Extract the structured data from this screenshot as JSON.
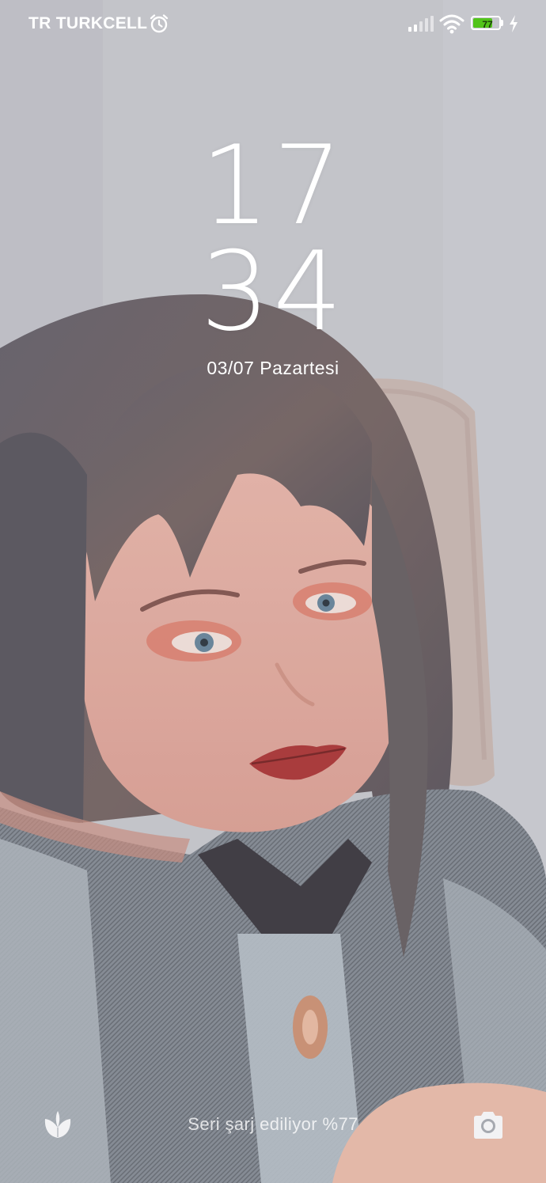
{
  "status_bar": {
    "carrier": "TR TURKCELL",
    "battery_level": "77",
    "battery_fraction": 0.77,
    "icons": [
      "alarm-clock-icon",
      "signal-strength-icon",
      "wifi-icon",
      "battery-icon",
      "charging-bolt-icon"
    ]
  },
  "lock_screen": {
    "clock_hours": "17",
    "clock_minutes": "34",
    "date": "03/07 Pazartesi"
  },
  "bottom_bar": {
    "charging_status": "Seri şarj ediliyor %77",
    "left_shortcut_icon": "leaf-icon",
    "right_shortcut_icon": "camera-icon"
  },
  "colors": {
    "battery_fill": "#52c41a",
    "text": "#ffffff"
  }
}
